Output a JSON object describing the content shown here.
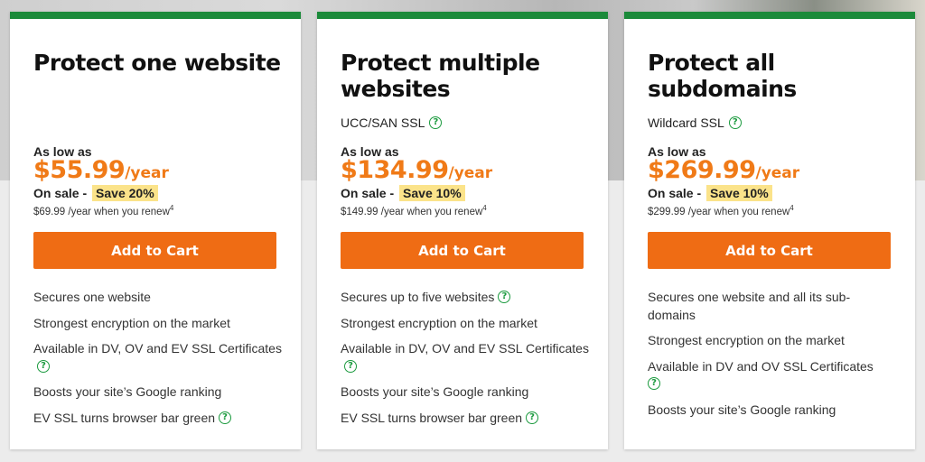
{
  "plans": [
    {
      "title": "Protect one website",
      "subtitle": "",
      "as_low_as": "As low as",
      "price": "$55.99",
      "per": "/year",
      "on_sale": "On sale -",
      "save": "Save 20%",
      "renew": "$69.99 /year when you renew",
      "renew_sup": "4",
      "button": "Add to Cart",
      "features": [
        "Secures one website",
        "Strongest encryption on the market",
        "Available in DV, OV and EV SSL Certificates",
        "Boosts your site’s Google ranking",
        "EV SSL turns browser bar green"
      ]
    },
    {
      "title": "Protect multiple websites",
      "subtitle": "UCC/SAN SSL",
      "as_low_as": "As low as",
      "price": "$134.99",
      "per": "/year",
      "on_sale": "On sale -",
      "save": "Save 10%",
      "renew": "$149.99 /year when you renew",
      "renew_sup": "4",
      "button": "Add to Cart",
      "features": [
        "Secures up to five websites",
        "Strongest encryption on the market",
        "Available in DV, OV and EV SSL Certificates",
        "Boosts your site’s Google ranking",
        "EV SSL turns browser bar green"
      ]
    },
    {
      "title": "Protect all subdomains",
      "subtitle": "Wildcard SSL",
      "as_low_as": "As low as",
      "price": "$269.99",
      "per": "/year",
      "on_sale": "On sale -",
      "save": "Save 10%",
      "renew": "$299.99 /year when you renew",
      "renew_sup": "4",
      "button": "Add to Cart",
      "features": [
        "Secures one website and all its sub-domains",
        "Strongest encryption on the market",
        "Available in DV and OV SSL Certificates",
        "Boosts your site’s Google ranking"
      ]
    }
  ],
  "help_glyph": "?",
  "colors": {
    "accent_green": "#1b8a3a",
    "price_orange": "#f07a17",
    "button_orange": "#ef6c14",
    "save_highlight": "#fbe38a"
  }
}
